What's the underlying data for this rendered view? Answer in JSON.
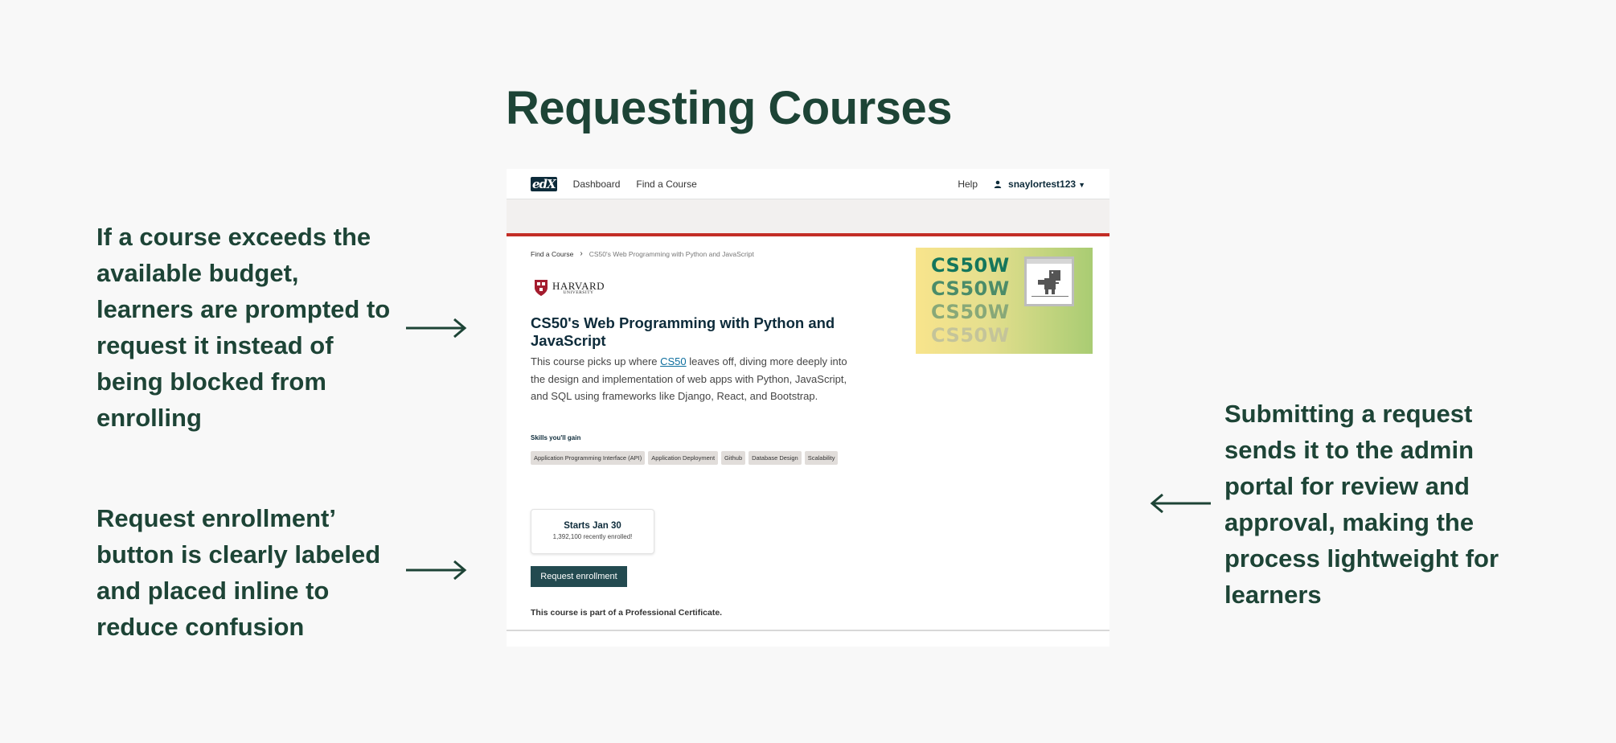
{
  "slide": {
    "title": "Requesting Courses",
    "notes": [
      "If a course exceeds the available budget, learners are prompted to request it instead of being blocked from enrolling",
      "Request enrollment’ button is clearly labeled and placed inline to reduce confusion",
      "Submitting a request sends it to the admin portal for review and approval, making the process lightweight for learners"
    ]
  },
  "colors": {
    "accent": "#1d4436",
    "brand_red": "#c32d26",
    "button": "#234a50",
    "page_bg": "#f8f8f8"
  },
  "header": {
    "logo": "edX",
    "nav": [
      "Dashboard",
      "Find a Course"
    ],
    "help": "Help",
    "username": "snaylortest123",
    "user_icon": "user-icon",
    "menu_icon": "chevron-down-icon"
  },
  "breadcrumb": {
    "parent": "Find a Course",
    "current": "CS50's Web Programming with Python and JavaScript"
  },
  "course": {
    "school": "HARVARD",
    "school_sub": "UNIVERSITY",
    "title": "CS50's Web Programming with Python and JavaScript",
    "description_before": "This course picks up where ",
    "description_link": "CS50",
    "description_after": " leaves off, diving more deeply into the design and implementation of web apps with Python, JavaScript, and SQL using frameworks like Django, React, and Bootstrap.",
    "skills_heading": "Skills you'll gain",
    "skills": [
      "Application Programming Interface (API)",
      "Application Deployment",
      "Github",
      "Database Design",
      "Scalability"
    ],
    "start": "Starts Jan 30",
    "enrolled": "1,392,100 recently enrolled!",
    "request_button": "Request enrollment",
    "certificate_note": "This course is part of a Professional Certificate.",
    "image_text": [
      "CS50W",
      "CS50W",
      "CS50W",
      "CS50W"
    ]
  }
}
